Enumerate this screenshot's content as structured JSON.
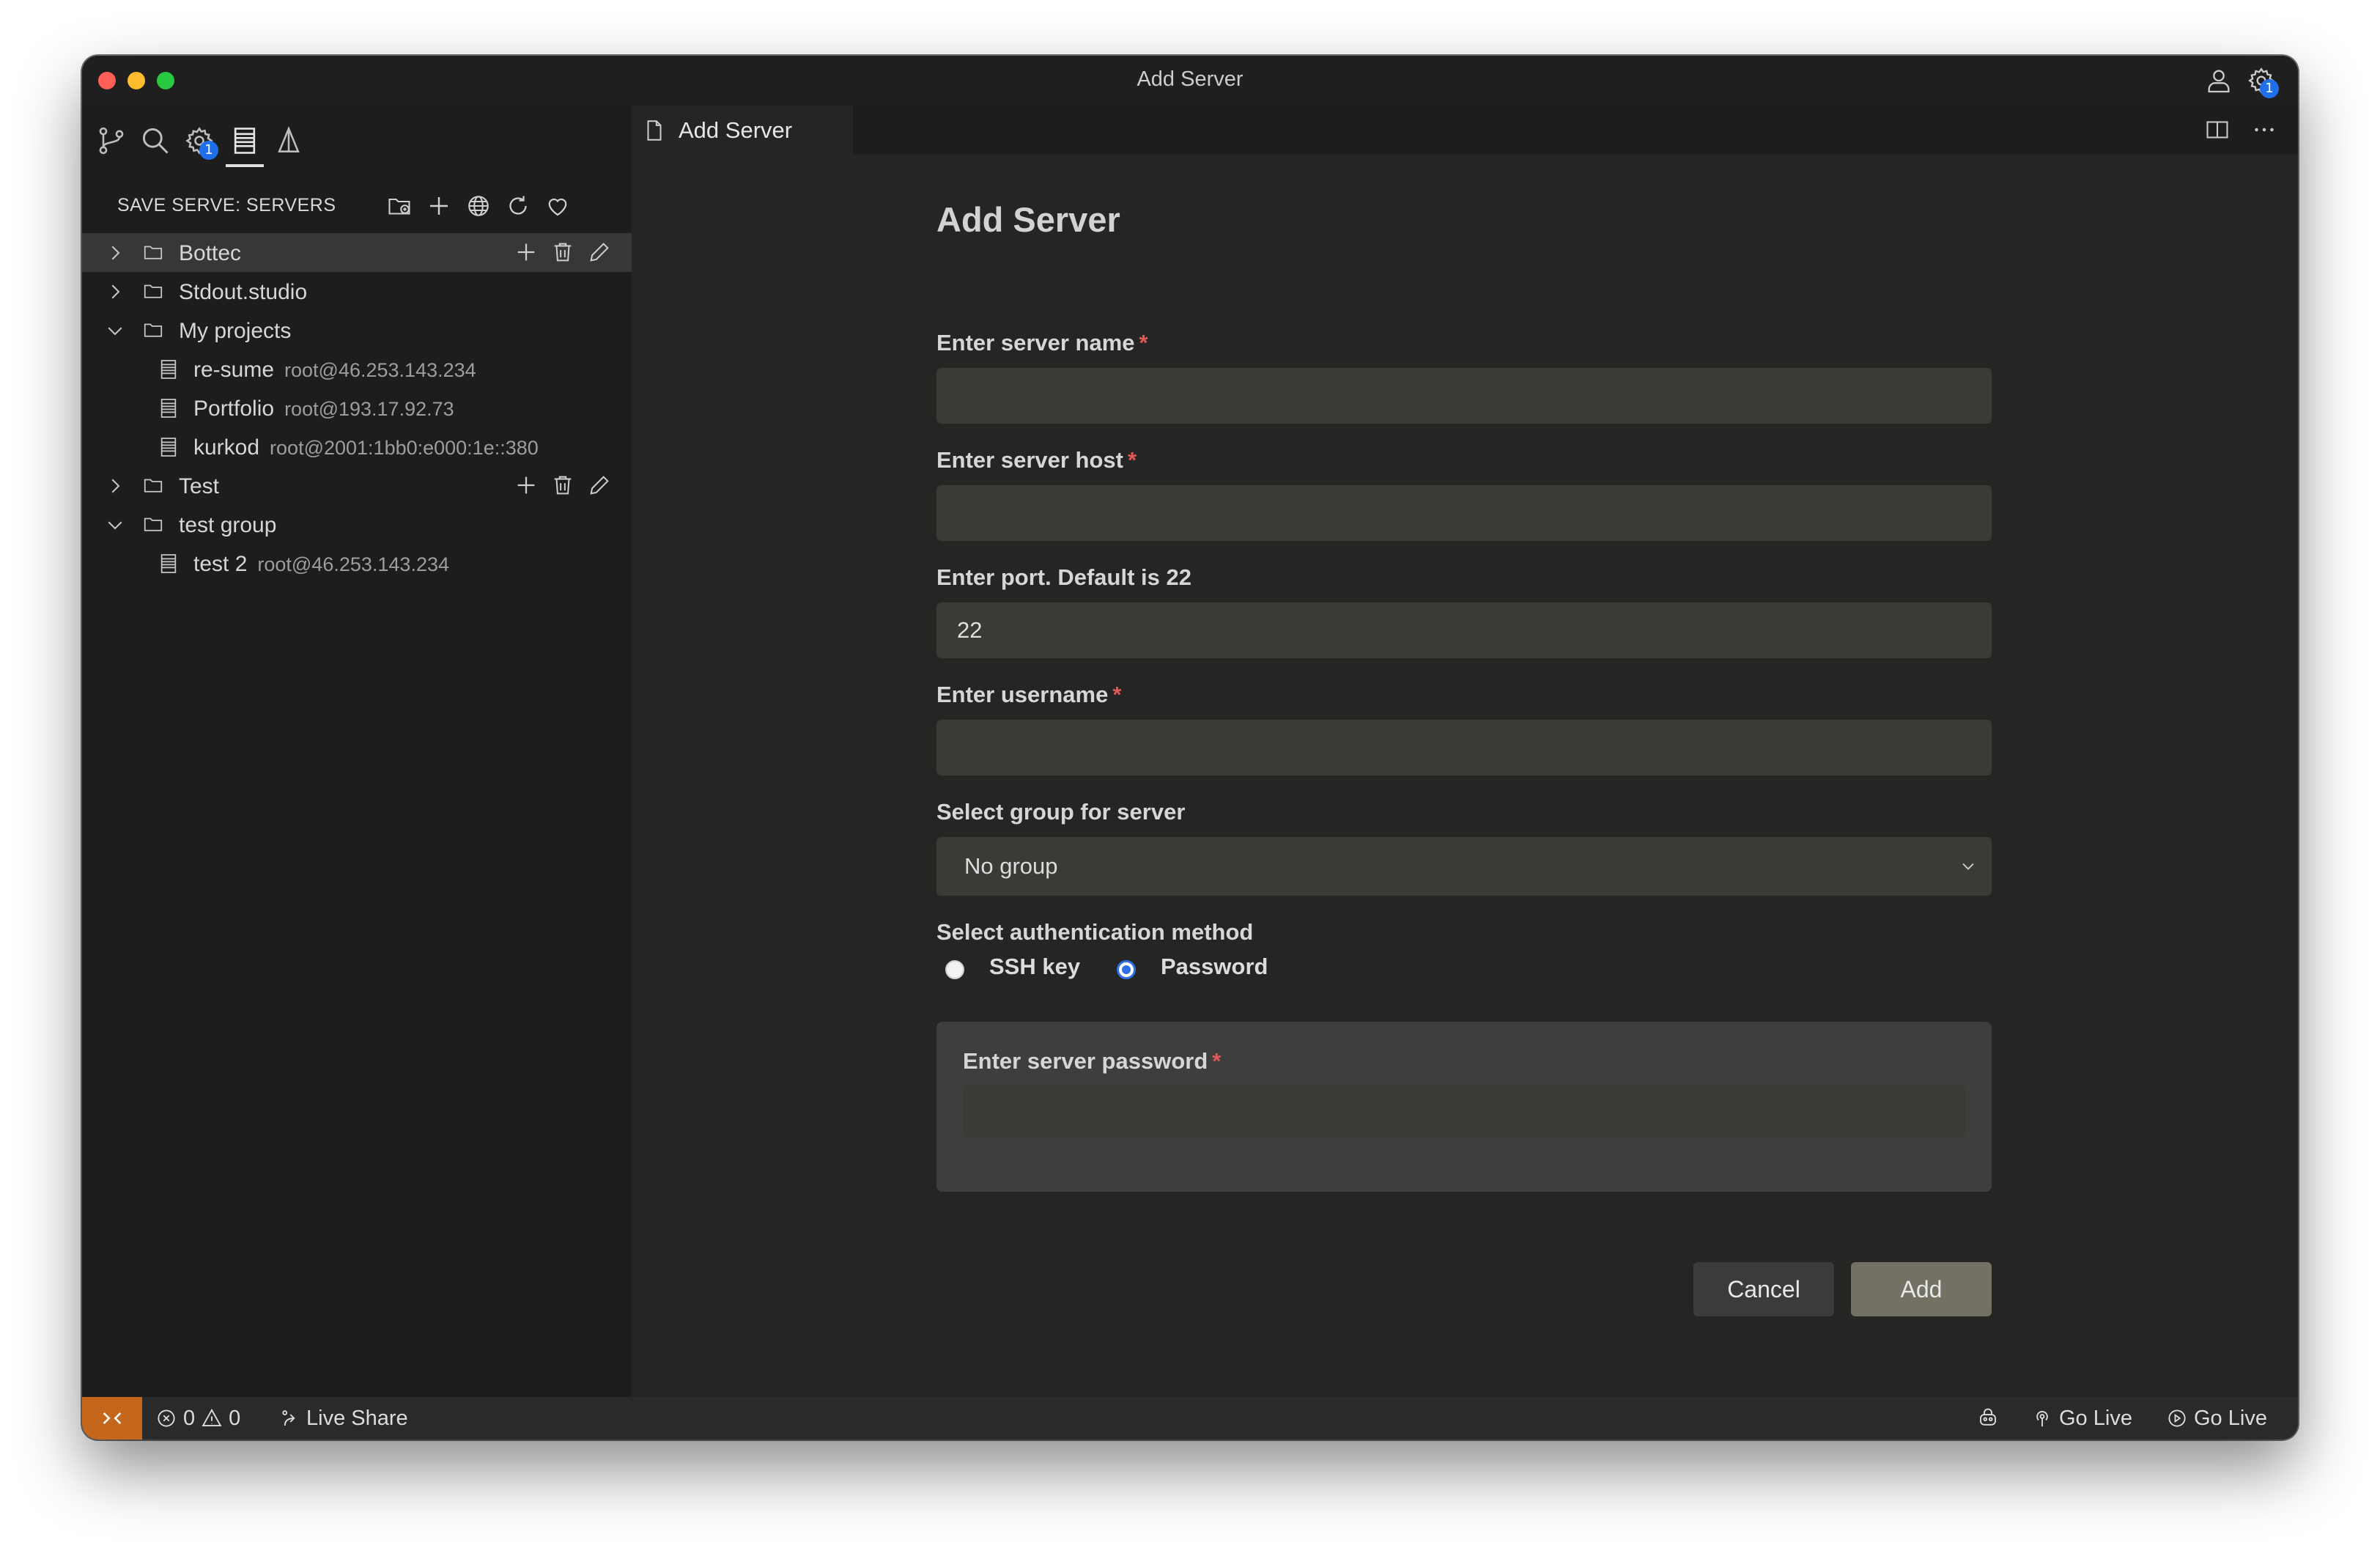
{
  "window": {
    "title": "Add Server"
  },
  "titlebar": {
    "settings_badge": "1"
  },
  "activity_bar": {
    "extensions_badge": "1"
  },
  "sidebar": {
    "section_title": "SAVE SERVE: SERVERS",
    "tree": [
      {
        "type": "folder",
        "label": "Bottec",
        "expanded": false,
        "selected": true
      },
      {
        "type": "folder",
        "label": "Stdout.studio",
        "expanded": false
      },
      {
        "type": "folder",
        "label": "My projects",
        "expanded": true
      },
      {
        "type": "server",
        "label": "re-sume",
        "detail": "root@46.253.143.234"
      },
      {
        "type": "server",
        "label": "Portfolio",
        "detail": "root@193.17.92.73"
      },
      {
        "type": "server",
        "label": "kurkod",
        "detail": "root@2001:1bb0:e000:1e::380"
      },
      {
        "type": "folder",
        "label": "Test",
        "expanded": false,
        "hover": true
      },
      {
        "type": "folder",
        "label": "test group",
        "expanded": true
      },
      {
        "type": "server",
        "label": "test 2",
        "detail": "root@46.253.143.234"
      }
    ]
  },
  "tabs": [
    {
      "label": "Add Server"
    }
  ],
  "form": {
    "heading": "Add Server",
    "name_label": "Enter server name",
    "name_value": "",
    "host_label": "Enter server host",
    "host_value": "",
    "port_label": "Enter port. Default is 22",
    "port_value": "22",
    "username_label": "Enter username",
    "username_value": "",
    "required_mark": "*",
    "group_label": "Select group for server",
    "group_value": "No group",
    "auth_label": "Select authentication method",
    "auth_options": [
      "SSH key",
      "Password"
    ],
    "auth_selected": "Password",
    "password_label": "Enter server password",
    "password_value": "",
    "cancel_label": "Cancel",
    "add_label": "Add"
  },
  "statusbar": {
    "errors": "0",
    "warnings": "0",
    "live_share": "Live Share",
    "go_live_1": "Go Live",
    "go_live_2": "Go Live"
  },
  "colors": {
    "remote_indicator": "#c5661d",
    "radio_selected": "#2f6ee9",
    "required": "#e45757",
    "add_button": "#727163"
  }
}
